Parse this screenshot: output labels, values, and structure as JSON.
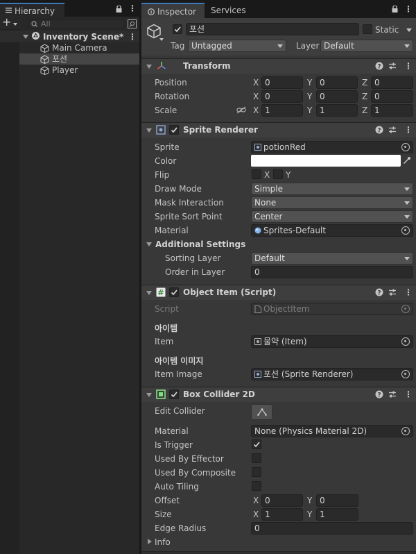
{
  "hierarchy": {
    "tab_label": "Hierarchy",
    "search_placeholder": "All",
    "scene_name": "Inventory Scene*",
    "items": [
      {
        "label": "Main Camera"
      },
      {
        "label": "포션"
      },
      {
        "label": "Player"
      }
    ]
  },
  "inspector": {
    "tab_label": "Inspector",
    "services_tab_label": "Services",
    "object": {
      "name": "포션",
      "static_label": "Static",
      "tag_label": "Tag",
      "tag_value": "Untagged",
      "layer_label": "Layer",
      "layer_value": "Default"
    },
    "transform": {
      "title": "Transform",
      "rows": [
        {
          "label": "Position",
          "x": "0",
          "y": "0",
          "z": "0"
        },
        {
          "label": "Rotation",
          "x": "0",
          "y": "0",
          "z": "0"
        },
        {
          "label": "Scale",
          "x": "1",
          "y": "1",
          "z": "1"
        }
      ]
    },
    "sprite_renderer": {
      "title": "Sprite Renderer",
      "sprite_label": "Sprite",
      "sprite_value": "potionRed",
      "color_label": "Color",
      "color_value": "#ffffff",
      "flip_label": "Flip",
      "flip_x": "X",
      "flip_y": "Y",
      "draw_mode_label": "Draw Mode",
      "draw_mode_value": "Simple",
      "mask_label": "Mask Interaction",
      "mask_value": "None",
      "sort_point_label": "Sprite Sort Point",
      "sort_point_value": "Center",
      "material_label": "Material",
      "material_value": "Sprites-Default",
      "additional_label": "Additional Settings",
      "sorting_layer_label": "Sorting Layer",
      "sorting_layer_value": "Default",
      "order_label": "Order in Layer",
      "order_value": "0"
    },
    "object_item": {
      "title": "Object Item (Script)",
      "script_label": "Script",
      "script_value": "ObjectItem",
      "section1": "아이템",
      "item_label": "Item",
      "item_value": "물약 (Item)",
      "section2": "아이템 이미지",
      "item_image_label": "Item Image",
      "item_image_value": "포션 (Sprite Renderer)"
    },
    "box_collider": {
      "title": "Box Collider 2D",
      "edit_label": "Edit Collider",
      "material_label": "Material",
      "material_value": "None (Physics Material 2D)",
      "trigger_label": "Is Trigger",
      "trigger_checked": true,
      "effector_label": "Used By Effector",
      "composite_label": "Used By Composite",
      "tiling_label": "Auto Tiling",
      "offset_label": "Offset",
      "offset_x": "0",
      "offset_y": "0",
      "size_label": "Size",
      "size_x": "1",
      "size_y": "1",
      "edge_label": "Edge Radius",
      "edge_value": "0",
      "info_label": "Info"
    }
  },
  "labels": {
    "x": "X",
    "y": "Y",
    "z": "Z"
  },
  "colors": {
    "accent": "#3a79bb",
    "panel": "#383838",
    "field": "#2a2a2a"
  }
}
